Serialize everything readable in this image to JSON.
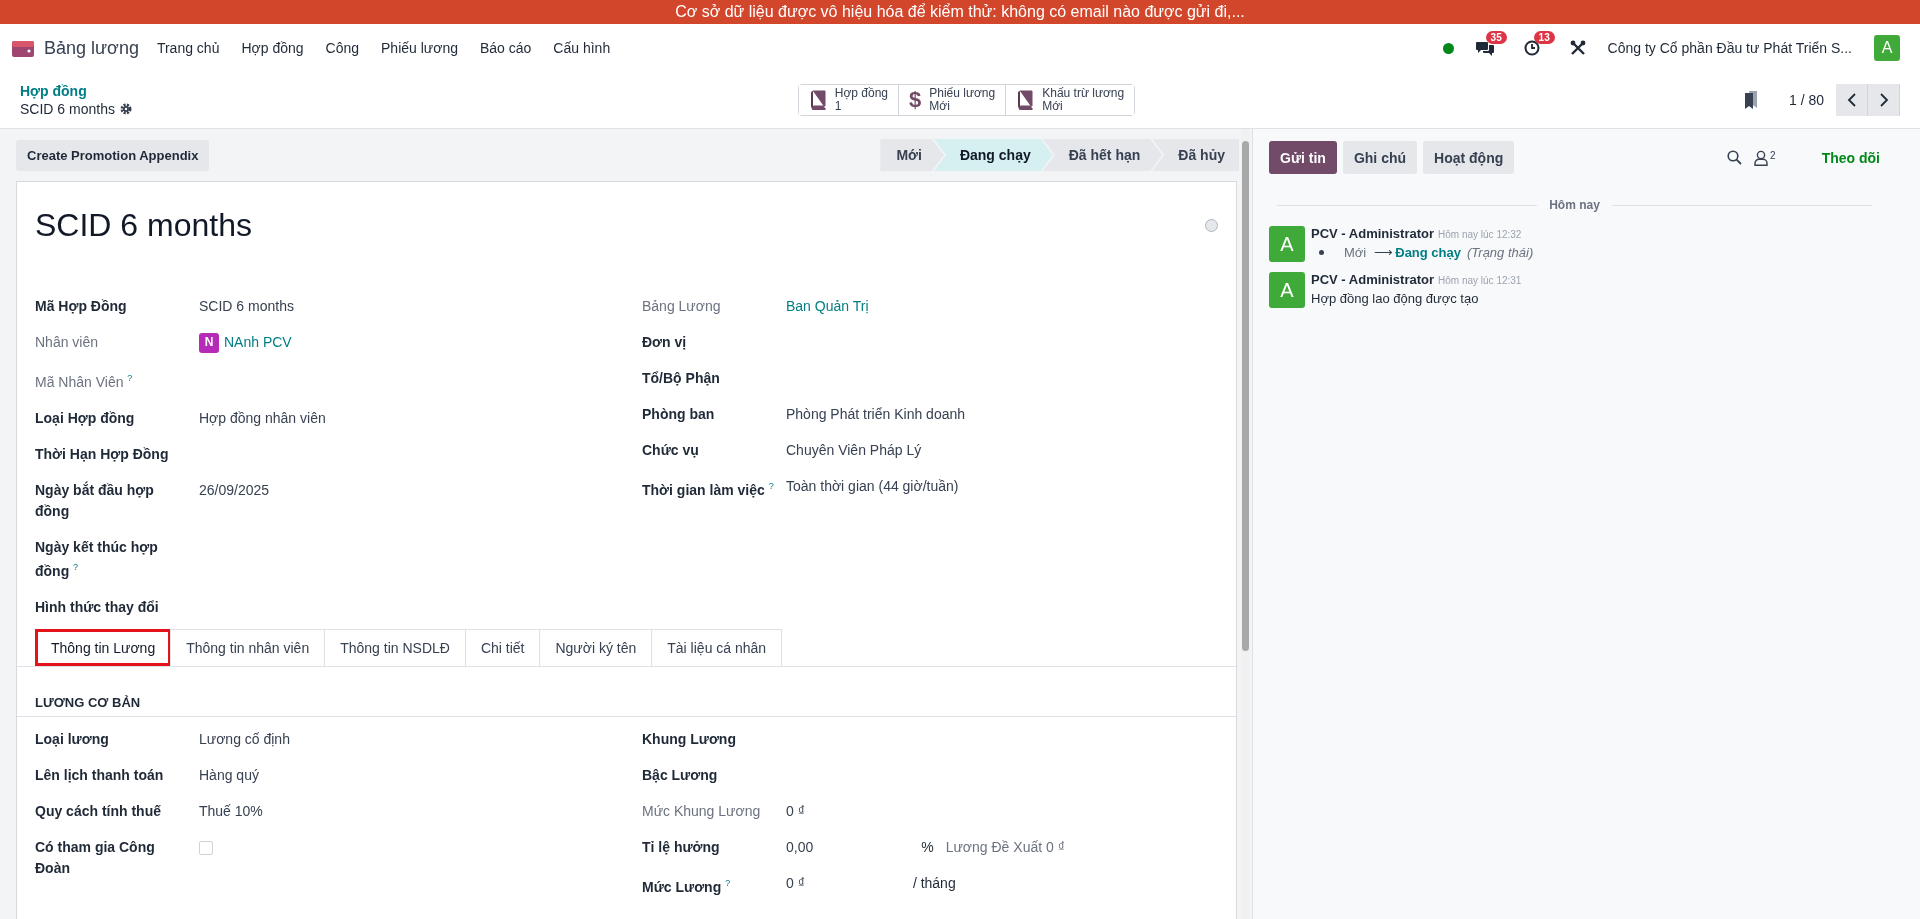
{
  "banner": {
    "text": "Cơ sở dữ liệu được vô hiệu hóa để kiểm thử: không có email nào được gửi đi,..."
  },
  "navbar": {
    "app_name": "Bảng lương",
    "menu": [
      "Trang chủ",
      "Hợp đồng",
      "Công",
      "Phiếu lương",
      "Báo cáo",
      "Cấu hình"
    ],
    "online": true,
    "messages_count": "35",
    "activities_count": "13",
    "company": "Công ty Cổ phần Đầu tư Phát Triển S...",
    "user_initial": "A"
  },
  "breadcrumb": {
    "parent": "Hợp đồng",
    "current": "SCID 6 months"
  },
  "smart_buttons": [
    {
      "kind": "book",
      "label": "Hợp đồng",
      "value": "1"
    },
    {
      "kind": "glyph",
      "glyph": "$",
      "label": "Phiếu lương",
      "value": "Mới"
    },
    {
      "kind": "book",
      "label": "Khấu trừ lương",
      "value": "Mới"
    }
  ],
  "pager": {
    "text": "1 / 80"
  },
  "action_buttons": [
    "Create Promotion Appendix"
  ],
  "stages": [
    {
      "label": "Mới",
      "selected": false
    },
    {
      "label": "Đang chạy",
      "selected": true
    },
    {
      "label": "Đã hết hạn",
      "selected": false
    },
    {
      "label": "Đã hủy",
      "selected": false
    }
  ],
  "title": "SCID 6 months",
  "fields_left": [
    {
      "label": "Mã Hợp Đồng",
      "readonly": false,
      "kind": "text",
      "value": "SCID 6 months"
    },
    {
      "label": "Nhân viên",
      "readonly": true,
      "kind": "avatar",
      "initial": "N",
      "value": "NAnh PCV"
    },
    {
      "label": "Mã Nhân Viên $^{?}$",
      "readonly": true,
      "kind": "empty"
    },
    {
      "label": "Loại Hợp đồng",
      "readonly": false,
      "kind": "text",
      "value": "Hợp đồng nhân viên"
    },
    {
      "label": "Thời Hạn Hợp Đồng",
      "readonly": false,
      "kind": "empty"
    },
    {
      "label": "Ngày bắt đầu hợp đồng",
      "readonly": false,
      "kind": "text",
      "value": "26/09/2025"
    },
    {
      "label": "Ngày kết thúc hợp đồng $^{?}$",
      "readonly": false,
      "kind": "empty"
    },
    {
      "label": "Hình thức thay đổi",
      "readonly": false,
      "kind": "empty"
    }
  ],
  "fields_right": [
    {
      "label": "Bảng Lương",
      "readonly": true,
      "kind": "link",
      "value": "Ban Quản Trị"
    },
    {
      "label": "Đơn vị",
      "readonly": false,
      "kind": "empty"
    },
    {
      "label": "Tổ/Bộ Phận",
      "readonly": false,
      "kind": "empty"
    },
    {
      "label": "Phòng ban",
      "readonly": false,
      "kind": "text",
      "value": "Phòng Phát triển Kinh doanh"
    },
    {
      "label": "Chức vụ",
      "readonly": false,
      "kind": "text",
      "value": "Chuyên Viên Pháp Lý"
    },
    {
      "label": "Thời gian làm việc $^{?}$",
      "readonly": false,
      "kind": "text",
      "value": "Toàn thời gian (44 giờ/tuần)"
    }
  ],
  "tabs": [
    {
      "label": "Thông tin Lương",
      "selected": true,
      "highlighted": true
    },
    {
      "label": "Thông tin nhân viên",
      "selected": false,
      "highlighted": false
    },
    {
      "label": "Thông tin NSDLĐ",
      "selected": false,
      "highlighted": false
    },
    {
      "label": "Chi tiết",
      "selected": false,
      "highlighted": false
    },
    {
      "label": "Người ký tên",
      "selected": false,
      "highlighted": false
    },
    {
      "label": "Tài liệu cá nhân",
      "selected": false,
      "highlighted": false
    }
  ],
  "salary_section": {
    "title": "LƯƠNG CƠ BẢN",
    "fields_left": [
      {
        "label": "Loại lương",
        "readonly": false,
        "kind": "text",
        "value": "Lương cố định"
      },
      {
        "label": "Lên lịch thanh toán",
        "readonly": false,
        "kind": "text",
        "value": "Hàng quý"
      },
      {
        "label": "Quy cách tính thuế",
        "readonly": false,
        "kind": "text",
        "value": "Thuế 10%"
      },
      {
        "label": "Có tham gia Công Đoàn",
        "readonly": false,
        "kind": "checkbox",
        "checked": false
      }
    ],
    "fields_right": [
      {
        "label": "Khung Lương",
        "readonly": false,
        "kind": "empty"
      },
      {
        "label": "Bậc Lương",
        "readonly": false,
        "kind": "empty"
      },
      {
        "label": "Mức Khung Lương",
        "readonly": true,
        "kind": "text",
        "value": "0 ₫"
      },
      {
        "label": "Tỉ lệ hưởng",
        "readonly": false,
        "kind": "text",
        "value": "0,00",
        "unit": "%",
        "note": "Lương Đề Xuất 0 ₫"
      },
      {
        "label": "Mức Lương $^{?}$",
        "readonly": false,
        "kind": "text",
        "value": "0 ₫",
        "unit": "/ tháng"
      }
    ]
  },
  "chatter": {
    "buttons": [
      {
        "label": "Gửi tin",
        "selected": true
      },
      {
        "label": "Ghi chú",
        "selected": false
      },
      {
        "label": "Hoạt động",
        "selected": false
      }
    ],
    "followers_count": "2",
    "follow": "Theo dõi",
    "date_separator": "Hôm nay",
    "messages": [
      {
        "avatar": "A",
        "author": "PCV - Administrator",
        "time": "Hôm nay lúc 12:32",
        "kind": "tracking",
        "old_value": "Mới",
        "arrow": "⟶",
        "new_value": "Đang chạy",
        "field": "(Trạng thái)"
      },
      {
        "avatar": "A",
        "author": "PCV - Administrator",
        "time": "Hôm nay lúc 12:31",
        "kind": "text",
        "body": "Hợp đồng lao động được tạo"
      }
    ]
  }
}
